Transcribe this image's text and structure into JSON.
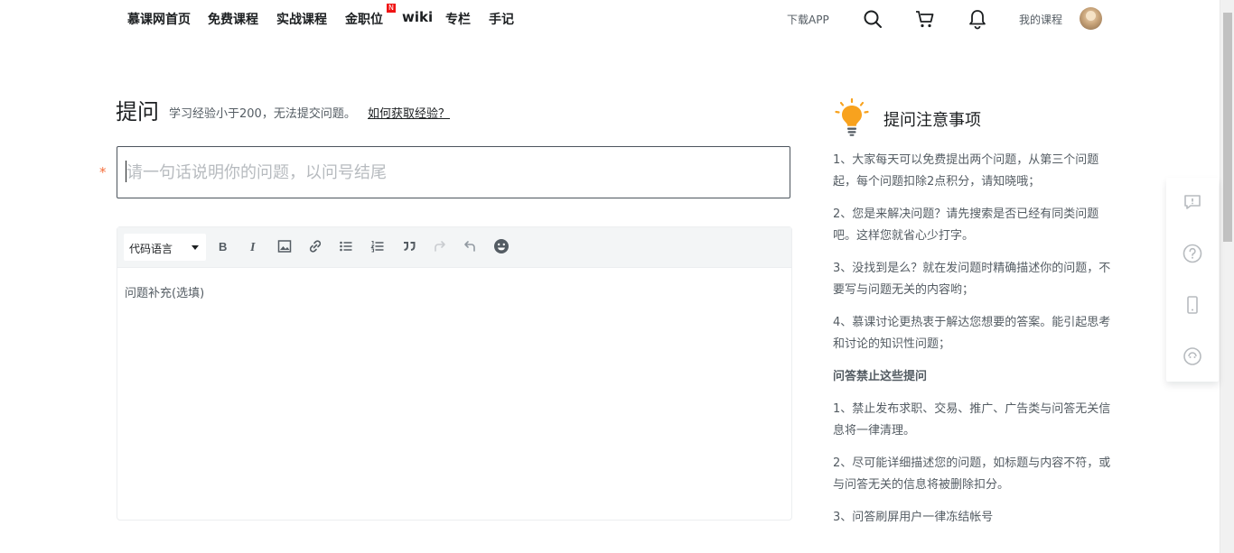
{
  "nav": {
    "items": [
      {
        "label": "慕课网首页"
      },
      {
        "label": "免费课程"
      },
      {
        "label": "实战课程"
      },
      {
        "label": "金职位"
      },
      {
        "label": "wiki"
      },
      {
        "label": "专栏"
      },
      {
        "label": "手记"
      }
    ],
    "new_badge": "N",
    "download_label": "下载APP",
    "my_courses_label": "我的课程",
    "icons": [
      "search-icon",
      "cart-icon",
      "bell-icon"
    ]
  },
  "form": {
    "title": "提问",
    "hint": "学习经验小于200，无法提交问题。",
    "hint_link": "如何获取经验？",
    "required_mark": "*",
    "question_placeholder": "请一句话说明你的问题，以问号结尾",
    "question_value": ""
  },
  "editor": {
    "language_label": "代码语言",
    "toolbar_icons": [
      "bold-icon",
      "italic-icon",
      "image-icon",
      "link-icon",
      "bullet-list-icon",
      "numbered-list-icon",
      "quote-icon",
      "redo-icon",
      "undo-icon",
      "emoji-icon"
    ],
    "body_placeholder": "问题补充(选填)"
  },
  "tips": {
    "title": "提问注意事项",
    "items": [
      "1、大家每天可以免费提出两个问题，从第三个问题起，每个问题扣除2点积分，请知晓哦；",
      "2、您是来解决问题？请先搜索是否已经有同类问题吧。这样您就省心少打字。",
      "3、没找到是么？就在发问题时精确描述你的问题，不要写与问题无关的内容哟；",
      "4、慕课讨论更热衷于解达您想要的答案。能引起思考和讨论的知识性问题；"
    ],
    "forbidden_title": "问答禁止这些提问",
    "forbidden_items": [
      "1、禁止发布求职、交易、推广、广告类与问答无关信息将一律清理。",
      "2、尽可能详细描述您的问题，如标题与内容不符，或与问答无关的信息将被删除扣分。",
      "3、问答刷屏用户一律冻结帐号"
    ]
  },
  "side_tools": [
    "feedback-icon",
    "help-icon",
    "mobile-icon",
    "support-icon"
  ],
  "colors": {
    "required": "#f56f3d",
    "bulb": "#f8a21e",
    "badge": "#f01414"
  }
}
